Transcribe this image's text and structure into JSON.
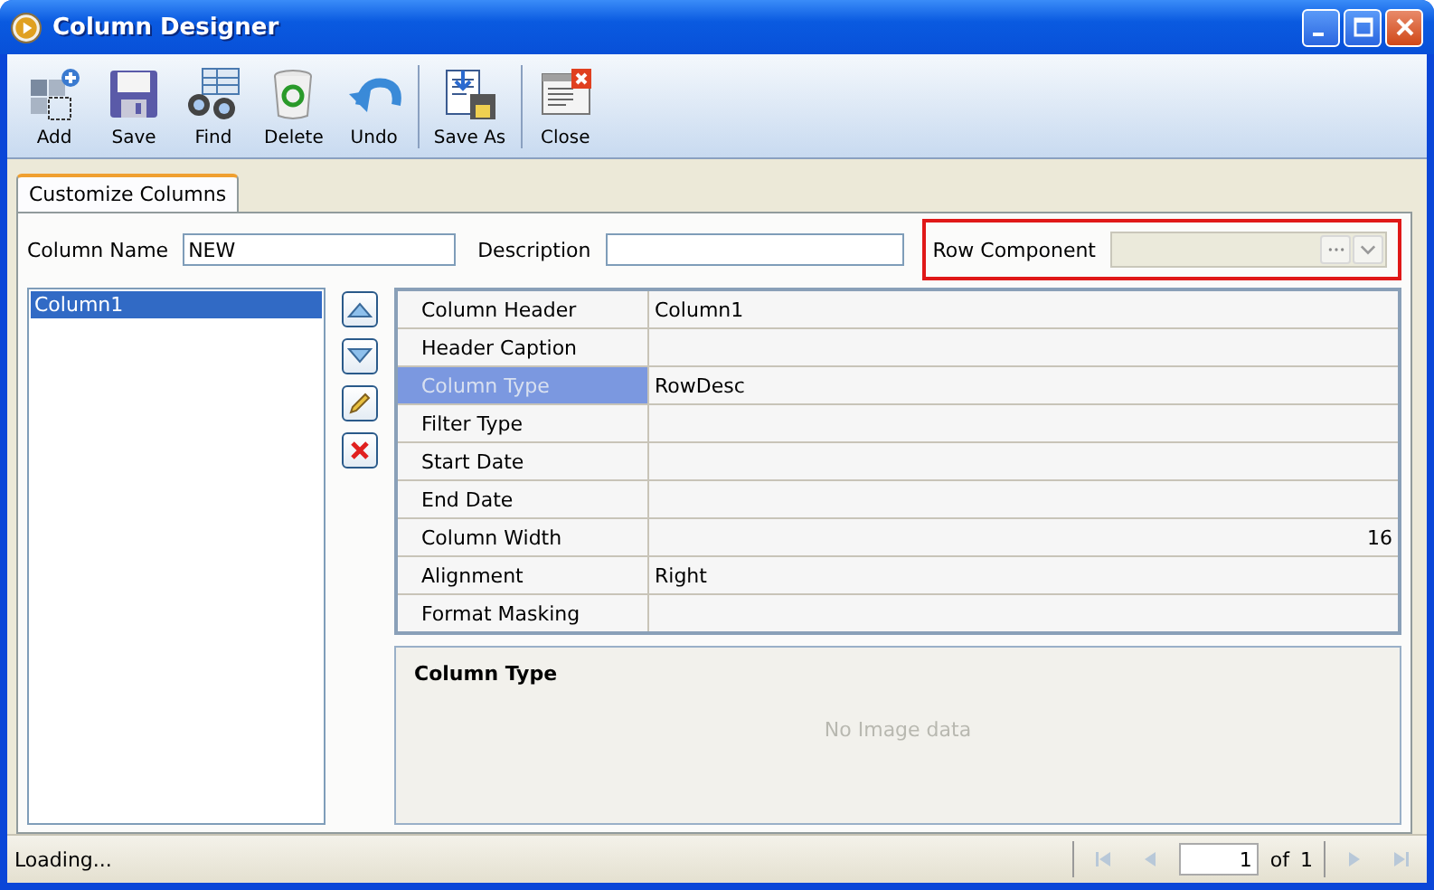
{
  "window": {
    "title": "Column Designer"
  },
  "toolbar": [
    {
      "label": "Add",
      "kind": "add"
    },
    {
      "label": "Save",
      "kind": "save"
    },
    {
      "label": "Find",
      "kind": "find"
    },
    {
      "label": "Delete",
      "kind": "delete"
    },
    {
      "label": "Undo",
      "kind": "undo"
    },
    {
      "label": "Save As",
      "kind": "saveas"
    },
    {
      "label": "Close",
      "kind": "close"
    }
  ],
  "tabs": [
    {
      "label": "Customize Columns",
      "selected": true
    }
  ],
  "fields": {
    "column_name": {
      "label": "Column Name",
      "value": "NEW"
    },
    "description": {
      "label": "Description"
    },
    "row_component": {
      "label": "Row Component",
      "disabled": true,
      "highlighted": true
    }
  },
  "columns_list": [
    {
      "label": "Column1",
      "selected": true
    }
  ],
  "side_buttons": [
    {
      "kind": "up"
    },
    {
      "kind": "down"
    },
    {
      "kind": "edit"
    },
    {
      "kind": "delete"
    }
  ],
  "properties": [
    {
      "name": "Column Header",
      "value": "Column1",
      "selected": false
    },
    {
      "name": "Header Caption",
      "selected": false
    },
    {
      "name": "Column Type",
      "value": "RowDesc",
      "selected": true
    },
    {
      "name": "Filter Type",
      "selected": false
    },
    {
      "name": "Start Date",
      "selected": false
    },
    {
      "name": "End Date",
      "selected": false
    },
    {
      "name": "Column Width",
      "value": "16",
      "right_aligned": true,
      "selected": false
    },
    {
      "name": "Alignment",
      "value": "Right",
      "selected": false
    },
    {
      "name": "Format Masking",
      "selected": false
    }
  ],
  "description_panel": {
    "title": "Column Type",
    "placeholder_text": "No Image data"
  },
  "status_bar": {
    "text": "Loading...",
    "page": "1",
    "of_label": "of",
    "total": "1"
  }
}
